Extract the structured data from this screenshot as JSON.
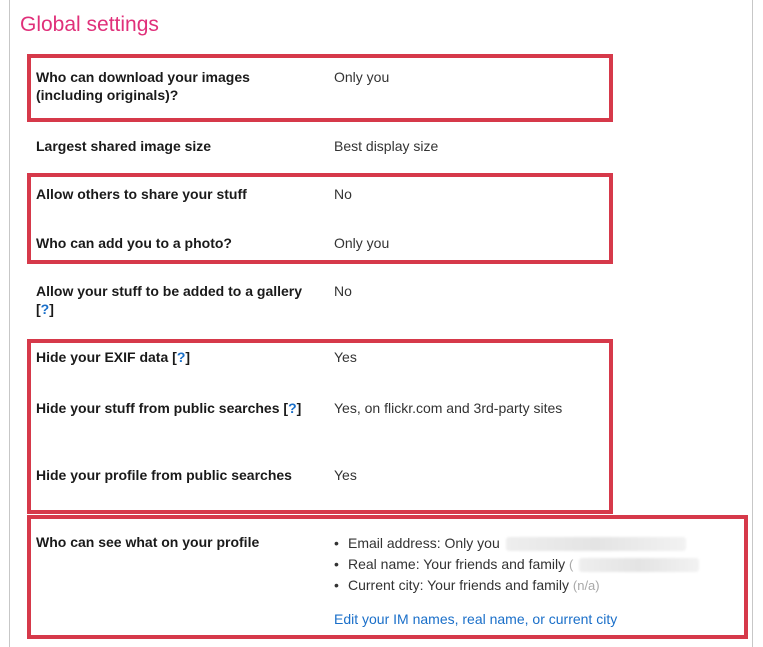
{
  "title": "Global settings",
  "help_mark": "?",
  "rows": {
    "download": {
      "label": "Who can download your images (including originals)?",
      "value": "Only you"
    },
    "largest": {
      "label": "Largest shared image size",
      "value": "Best display size"
    },
    "share": {
      "label": "Allow others to share your stuff",
      "value": "No"
    },
    "addphoto": {
      "label": "Who can add you to a photo?",
      "value": "Only you"
    },
    "gallery": {
      "label": "Allow your stuff to be added to a gallery",
      "value": "No"
    },
    "exif": {
      "label": "Hide your EXIF data",
      "value": "Yes"
    },
    "search": {
      "label": "Hide your stuff from public searches",
      "value": "Yes, on flickr.com and 3rd-party sites"
    },
    "profile_search": {
      "label": "Hide your profile from public searches",
      "value": "Yes"
    },
    "profile": {
      "label": "Who can see what on your profile",
      "items": [
        "Email address: Only you",
        "Real name: Your friends and family",
        "Current city: Your friends and family"
      ],
      "city_note": "(n/a)",
      "realname_note": "(",
      "edit_link": "Edit your IM names, real name, or current city"
    }
  },
  "colors": {
    "title": "#e0307a",
    "highlight": "#d6394a",
    "link": "#1a6fc9"
  }
}
